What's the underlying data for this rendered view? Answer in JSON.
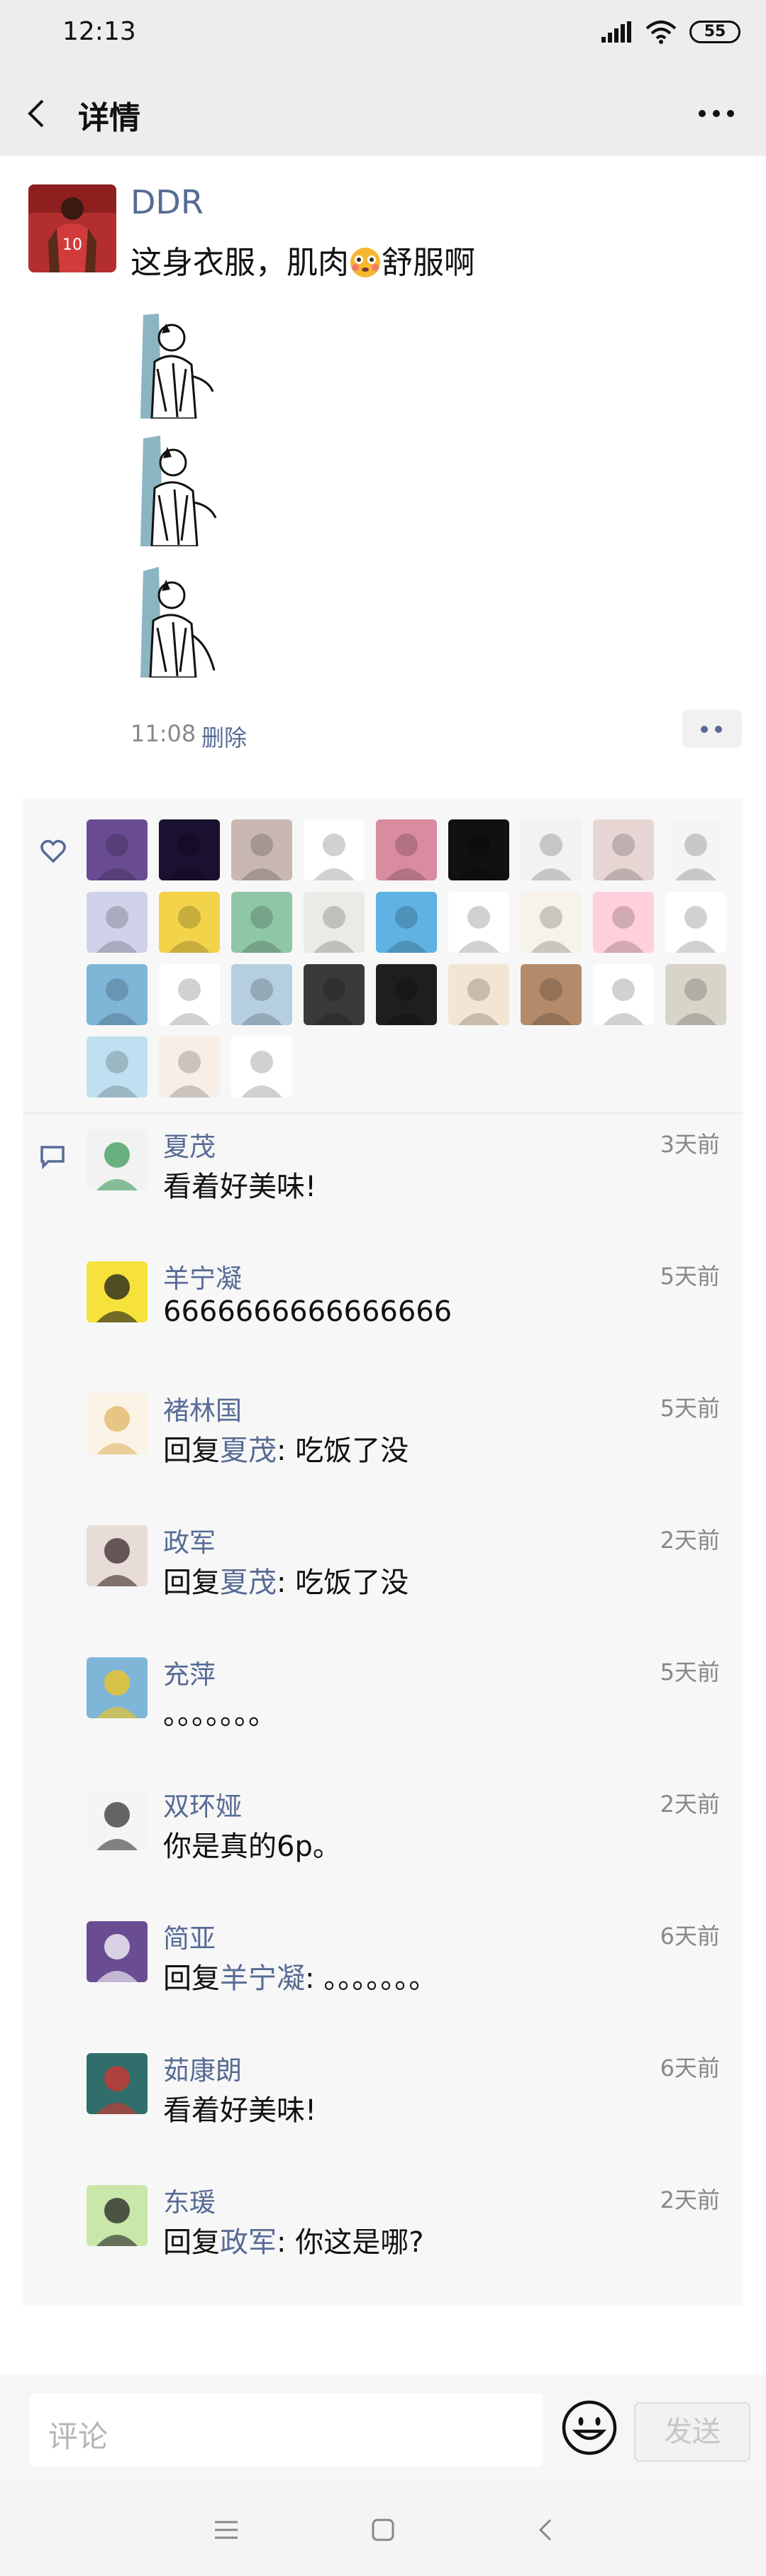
{
  "status_bar": {
    "time": "12:13",
    "battery": "55"
  },
  "nav": {
    "title": "详情"
  },
  "post": {
    "author": "DDR",
    "text_before": "这身衣服，肌肉",
    "text_after": "舒服啊",
    "time": "11:08",
    "delete_label": "删除"
  },
  "likes": [
    {
      "name": "cat-avatar",
      "bg": "#6a4c93"
    },
    {
      "name": "neon-avatar",
      "bg": "#1a1030"
    },
    {
      "name": "girl-avatar",
      "bg": "#c9b8b1"
    },
    {
      "name": "ink-avatar",
      "bg": "#ffffff"
    },
    {
      "name": "pink-avatar",
      "bg": "#d98ba0"
    },
    {
      "name": "ring-avatar",
      "bg": "#111111"
    },
    {
      "name": "silhouette-avatar",
      "bg": "#f2f2f2"
    },
    {
      "name": "doll-avatar",
      "bg": "#e7d6d3"
    },
    {
      "name": "wang-avatar",
      "bg": "#f5f5f5"
    },
    {
      "name": "anime-avatar",
      "bg": "#cfd2e8"
    },
    {
      "name": "glasses-avatar",
      "bg": "#f3d34a"
    },
    {
      "name": "green-girl-avatar",
      "bg": "#8fc7a6"
    },
    {
      "name": "lady-avatar",
      "bg": "#eceae6"
    },
    {
      "name": "sky-avatar",
      "bg": "#5fb2e2"
    },
    {
      "name": "cartoon-man-avatar",
      "bg": "#ffffff"
    },
    {
      "name": "couple-avatar",
      "bg": "#f7f2ea"
    },
    {
      "name": "rabbit-avatar",
      "bg": "#ffd0dc"
    },
    {
      "name": "red-girl-avatar",
      "bg": "#ffffff"
    },
    {
      "name": "sunflower-avatar",
      "bg": "#7fb6d8"
    },
    {
      "name": "red-cartoon-avatar",
      "bg": "#ffffff"
    },
    {
      "name": "sea-avatar",
      "bg": "#b5cfe0"
    },
    {
      "name": "sunset-avatar",
      "bg": "#3a3a3a"
    },
    {
      "name": "zhou-avatar",
      "bg": "#1e1e1e"
    },
    {
      "name": "kids-avatar",
      "bg": "#f2e5d4"
    },
    {
      "name": "man-avatar",
      "bg": "#b38a6a"
    },
    {
      "name": "wechat-avatar",
      "bg": "#ffffff"
    },
    {
      "name": "xu-avatar",
      "bg": "#d8d4c8"
    },
    {
      "name": "pig-avatar",
      "bg": "#bfe0f0"
    },
    {
      "name": "pig2-avatar",
      "bg": "#f7eee8"
    },
    {
      "name": "tiny-avatar",
      "bg": "#ffffff"
    }
  ],
  "comments": [
    {
      "name": "夏茂",
      "time": "3天前",
      "text": "看着好美味!",
      "reply_to": "",
      "av": "#f2f2f2",
      "av_accent": "#3a9a5a"
    },
    {
      "name": "羊宁凝",
      "time": "5天前",
      "text": "6666666666666666",
      "reply_to": "",
      "av": "#f6e23a",
      "av_accent": "#1a1a1a"
    },
    {
      "name": "褚林国",
      "time": "5天前",
      "text": ": 吃饭了没",
      "reply_to": "夏茂",
      "av": "#fbf3e6",
      "av_accent": "#e0b563"
    },
    {
      "name": "政军",
      "time": "2天前",
      "text": ": 吃饭了没",
      "reply_to": "夏茂",
      "av": "#e8dcd8",
      "av_accent": "#3a2a2a"
    },
    {
      "name": "充萍",
      "time": "5天前",
      "text": "。。。。。。。",
      "reply_to": "",
      "av": "#7fb6d8",
      "av_accent": "#f5c518"
    },
    {
      "name": "双环娅",
      "time": "2天前",
      "text": "你是真的6p。",
      "reply_to": "",
      "av": "#f5f5f5",
      "av_accent": "#333333"
    },
    {
      "name": "简亚",
      "time": "6天前",
      "text": ": 。。。。。。。",
      "reply_to": "羊宁凝",
      "av": "#6a4c93",
      "av_accent": "#ffffff"
    },
    {
      "name": "茹康朗",
      "time": "6天前",
      "text": "看着好美味!",
      "reply_to": "",
      "av": "#2f6e6a",
      "av_accent": "#d8332f"
    },
    {
      "name": "东瑗",
      "time": "2天前",
      "text": ": 你这是哪?",
      "reply_to": "政军",
      "av": "#c9e7a8",
      "av_accent": "#222222"
    }
  ],
  "reply_prefix": "回复",
  "input": {
    "placeholder": "评论",
    "send_label": "发送"
  },
  "colors": {
    "link": "#576b95",
    "panel": "#f7f7f7",
    "bar": "#ededed"
  }
}
